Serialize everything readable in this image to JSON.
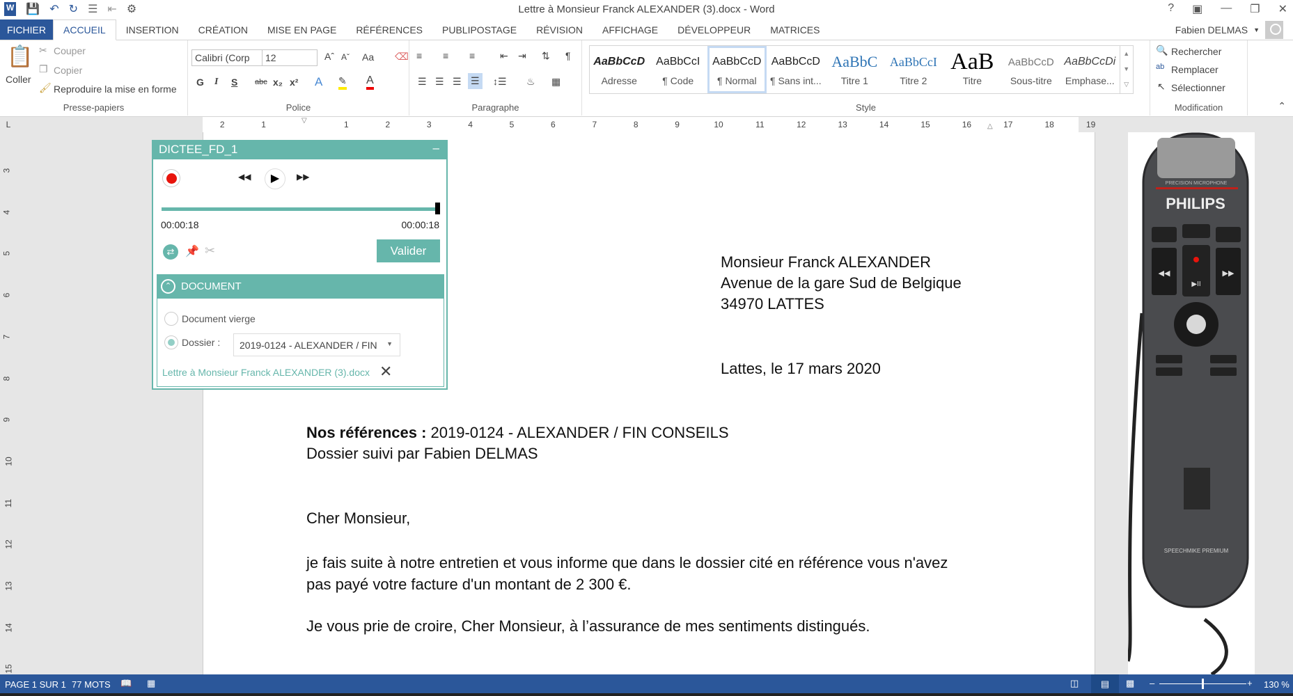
{
  "window": {
    "title": "Lettre à Monsieur Franck ALEXANDER (3).docx - Word",
    "help": "?",
    "user": "Fabien DELMAS"
  },
  "tabs": [
    "FICHIER",
    "ACCUEIL",
    "INSERTION",
    "CRÉATION",
    "MISE EN PAGE",
    "RÉFÉRENCES",
    "PUBLIPOSTAGE",
    "RÉVISION",
    "AFFICHAGE",
    "DÉVELOPPEUR",
    "MATRICES"
  ],
  "active_tab": "ACCUEIL",
  "ribbon": {
    "clipboard": {
      "label": "Presse-papiers",
      "paste": "Coller",
      "cut": "Couper",
      "copy": "Copier",
      "format_painter": "Reproduire la mise en forme"
    },
    "font": {
      "label": "Police",
      "font_name": "Calibri (Corp",
      "font_size": "12",
      "bold": "G",
      "italic": "I",
      "underline": "S",
      "strike": "abc",
      "case": "Aa"
    },
    "paragraph": {
      "label": "Paragraphe"
    },
    "styles": {
      "label": "Style",
      "items": [
        {
          "preview": "AaBbCcD",
          "name": "Adresse"
        },
        {
          "preview": "AaBbCcI",
          "name": "¶ Code"
        },
        {
          "preview": "AaBbCcD",
          "name": "¶ Normal"
        },
        {
          "preview": "AaBbCcD",
          "name": "¶ Sans int..."
        },
        {
          "preview": "AaBbC",
          "name": "Titre 1"
        },
        {
          "preview": "AaBbCcI",
          "name": "Titre 2"
        },
        {
          "preview": "AaB",
          "name": "Titre"
        },
        {
          "preview": "AaBbCcD",
          "name": "Sous-titre"
        },
        {
          "preview": "AaBbCcDi",
          "name": "Emphase..."
        }
      ]
    },
    "editing": {
      "label": "Modification",
      "find": "Rechercher",
      "replace": "Remplacer",
      "select": "Sélectionner"
    }
  },
  "ruler": {
    "corner": "L",
    "horizontal": [
      "2",
      "1",
      "1",
      "2",
      "3",
      "4",
      "5",
      "6",
      "7",
      "8",
      "9",
      "10",
      "11",
      "12",
      "13",
      "14",
      "15",
      "16",
      "17",
      "18",
      "19"
    ],
    "vertical": [
      "3",
      "4",
      "5",
      "6",
      "7",
      "8",
      "9",
      "10",
      "11",
      "12",
      "13",
      "14",
      "15"
    ]
  },
  "dictation": {
    "title": "DICTEE_FD_1",
    "position": "00:00:18",
    "duration": "00:00:18",
    "progress_percent": 100,
    "validate": "Valider",
    "section": "DOCUMENT",
    "option_blank": "Document vierge",
    "option_folder": "Dossier :",
    "folder_value": "2019-0124 - ALEXANDER / FIN",
    "selected_option": "Dossier",
    "linked_doc": "Lettre à Monsieur Franck ALEXANDER (3).docx"
  },
  "letter": {
    "address": [
      "Monsieur Franck ALEXANDER",
      "Avenue de la gare Sud de Belgique",
      "34970 LATTES"
    ],
    "date": "Lattes, le 17 mars 2020",
    "ref_label": "Nos références :",
    "ref_value": " 2019-0124 - ALEXANDER / FIN CONSEILS",
    "followed": "Dossier suivi par Fabien DELMAS",
    "greeting": "Cher Monsieur,",
    "body1": "je fais suite à notre entretien et vous informe que dans le dossier cité en référence vous n'avez",
    "body2": "pas payé votre facture d'un montant de 2 300 €.",
    "closing": "Je vous prie de croire, Cher Monsieur, à l’assurance de mes sentiments distingués."
  },
  "device_image": {
    "brand": "PHILIPS",
    "model": "SPEECHMIKE PREMIUM",
    "top_text": "PRECISION MICROPHONE"
  },
  "statusbar": {
    "page": "PAGE 1 SUR 1",
    "words": "77 MOTS",
    "zoom": "130 %",
    "zoom_percent": 130
  },
  "colors": {
    "word_blue": "#2b579a",
    "teal": "#66b6ab",
    "record_red": "#e8140c"
  }
}
